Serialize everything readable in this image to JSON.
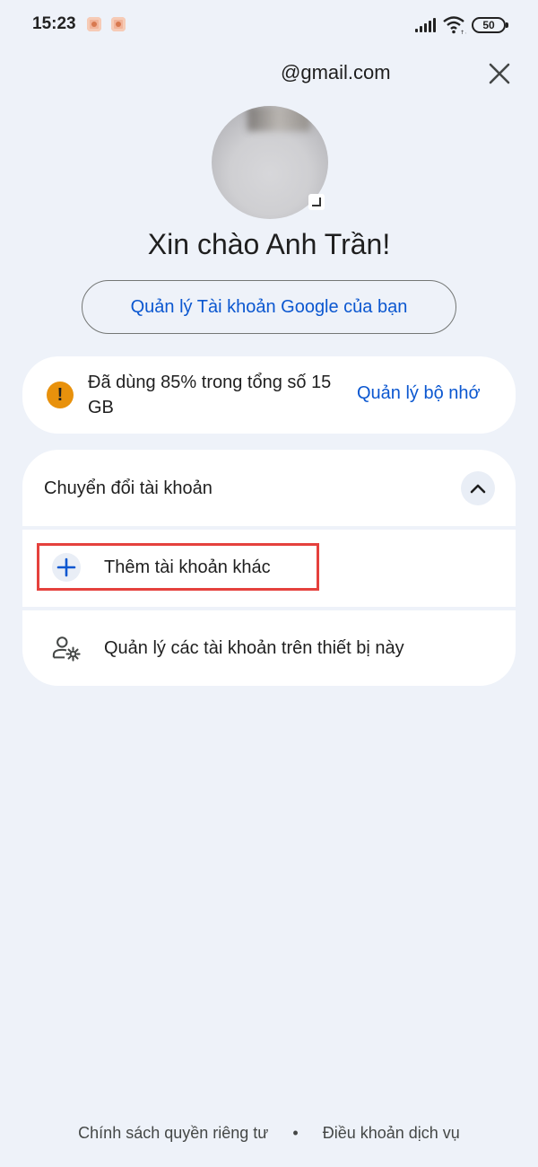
{
  "status_bar": {
    "time": "15:23",
    "battery_level": "50",
    "icons": [
      "notification-icon",
      "notification-icon",
      "signal-icon",
      "wifi-icon",
      "battery-icon"
    ]
  },
  "header": {
    "email": "@gmail.com",
    "close_icon": "close-icon"
  },
  "profile": {
    "greeting": "Xin chào Anh Trần!",
    "manage_account_label": "Quản lý Tài khoản Google của bạn"
  },
  "storage": {
    "message": "Đã dùng 85% trong tổng số 15 GB",
    "usage_percent": 85,
    "total": "15 GB",
    "manage_label": "Quản lý bộ nhớ",
    "warning_color": "#e8910c"
  },
  "accounts": {
    "section_title": "Chuyển đổi tài khoản",
    "expanded": true,
    "items": [
      {
        "label": "Thêm tài khoản khác",
        "icon": "plus-icon",
        "highlighted": true
      },
      {
        "label": "Quản lý các tài khoản trên thiết bị này",
        "icon": "manage-accounts-icon",
        "highlighted": false
      }
    ]
  },
  "footer": {
    "privacy_label": "Chính sách quyền riêng tư",
    "separator": "•",
    "terms_label": "Điều khoản dịch vụ"
  },
  "colors": {
    "background": "#eef2f9",
    "link": "#0b57d0",
    "highlight": "#e5413d"
  }
}
